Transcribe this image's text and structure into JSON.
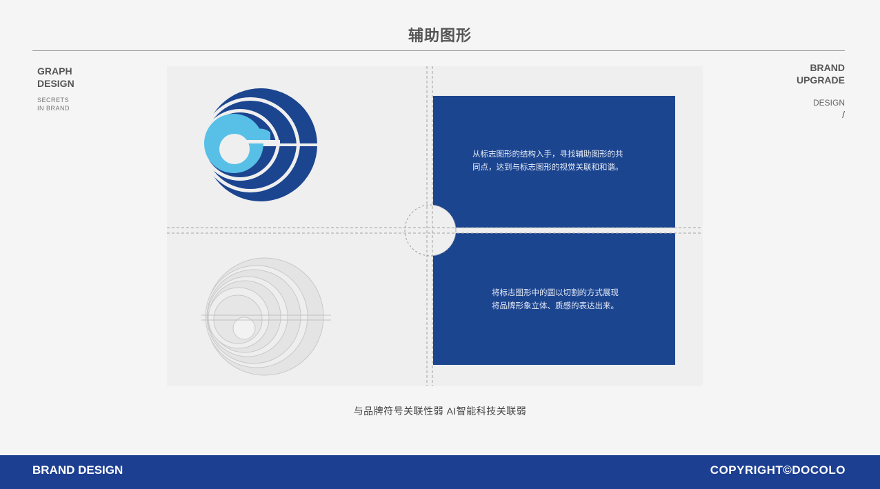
{
  "header": {
    "title": "辅助图形"
  },
  "left_block": {
    "line1": "GRAPH",
    "line2": "DESIGN",
    "sub1": "SECRETS",
    "sub2": "IN BRAND"
  },
  "right_block": {
    "line1": "BRAND",
    "line2": "UPGRADE",
    "sub": "DESIGN",
    "slash": "/"
  },
  "panel": {
    "text_top": [
      "从标志图形的结构入手，寻找辅助图形的共",
      "同点，达到与标志图形的视觉关联和和谐。"
    ],
    "text_bottom": [
      "将标志图形中的圆以切割的方式展现",
      "将品牌形象立体、质感的表达出来。"
    ]
  },
  "caption": "与品牌符号关联性弱  AI智能科技关联弱",
  "footer": {
    "left": "BRAND DESIGN",
    "right": "COPYRIGHT©DOCOLO"
  },
  "colors": {
    "brand_blue": "#1c4590",
    "light_blue": "#58c0e6",
    "footer_blue": "#1c3f92",
    "background": "#f5f5f5"
  }
}
